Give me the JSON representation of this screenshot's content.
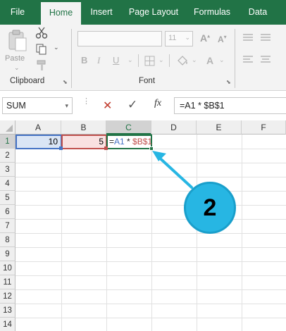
{
  "tabs": [
    {
      "label": "File",
      "active": false
    },
    {
      "label": "Home",
      "active": true
    },
    {
      "label": "Insert",
      "active": false
    },
    {
      "label": "Page Layout",
      "active": false
    },
    {
      "label": "Formulas",
      "active": false
    },
    {
      "label": "Data",
      "active": false
    }
  ],
  "ribbon": {
    "clipboard_label": "Clipboard",
    "paste_label": "Paste",
    "font_label": "Font",
    "font_size": "11",
    "bold": "B",
    "italic": "I",
    "underline": "U",
    "grow_font": "A",
    "shrink_font": "A",
    "font_color": "A"
  },
  "formula_bar": {
    "name_box": "SUM",
    "cancel_icon": "✕",
    "enter_icon": "✓",
    "fx_label": "fx",
    "formula": "=A1 * $B$1"
  },
  "grid": {
    "columns": [
      "A",
      "B",
      "C",
      "D",
      "E",
      "F"
    ],
    "rows": [
      "1",
      "2",
      "3",
      "4",
      "5",
      "6",
      "7",
      "8",
      "9",
      "10",
      "11",
      "12",
      "13",
      "14"
    ],
    "cells": {
      "A1": "10",
      "B1": "5",
      "C1_part1": "=",
      "C1_part2": "A1",
      "C1_part3": " * ",
      "C1_part4": "$B$1"
    },
    "active_cell": "C1"
  },
  "callout": {
    "number": "2"
  },
  "colors": {
    "brand": "#217346",
    "ref_blue": "#4472c4",
    "ref_red": "#c0504d",
    "callout": "#27b6e3"
  }
}
